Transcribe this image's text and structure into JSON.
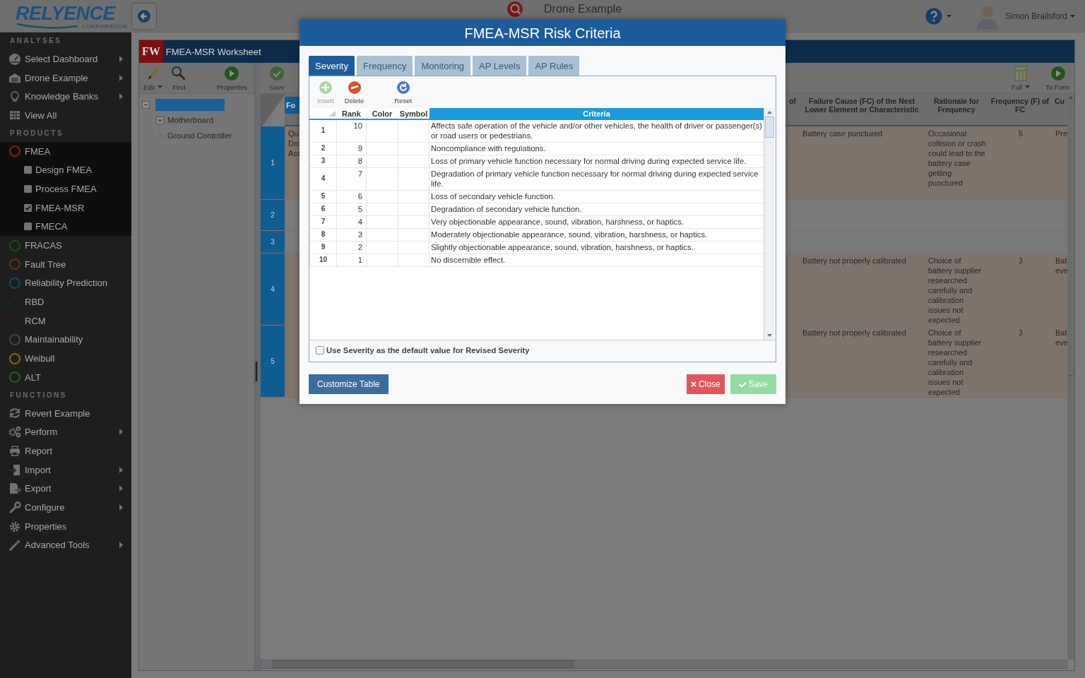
{
  "topbar": {
    "logo": "RELYENCE",
    "logo_sub": "CORPORATION",
    "title": "Drone Example",
    "user": "Simon Brailsford"
  },
  "sidebar": {
    "sections": [
      {
        "heading": "ANALYSES",
        "kind": "nav",
        "items": [
          {
            "label": "Select Dashboard",
            "submenu": true
          },
          {
            "label": "Drone Example",
            "submenu": true
          },
          {
            "label": "Knowledge Banks",
            "submenu": true
          },
          {
            "label": "View All",
            "submenu": false
          }
        ]
      },
      {
        "heading": "PRODUCTS",
        "kind": "products",
        "items": [
          {
            "label": "FMEA",
            "color": "#8c1c1c",
            "expanded": true,
            "children": [
              {
                "label": "Design FMEA",
                "checked": false
              },
              {
                "label": "Process FMEA",
                "checked": false
              },
              {
                "label": "FMEA-MSR",
                "checked": true
              },
              {
                "label": "FMECA",
                "checked": false
              }
            ]
          },
          {
            "label": "FRACAS",
            "color": "#1e4a1e",
            "expanded": false
          },
          {
            "label": "Fault Tree",
            "color": "#6e2a1c",
            "expanded": false
          },
          {
            "label": "Reliability Prediction",
            "color": "#124a62",
            "expanded": false
          },
          {
            "label": "RBD",
            "color": "#1a2438",
            "expanded": false
          },
          {
            "label": "RCM",
            "color": "#3a1414",
            "expanded": false
          },
          {
            "label": "Maintainability",
            "color": "#444444",
            "expanded": false
          },
          {
            "label": "Weibull",
            "color": "#7a6818",
            "expanded": false
          },
          {
            "label": "ALT",
            "color": "#2e5c1c",
            "expanded": false
          }
        ]
      },
      {
        "heading": "FUNCTIONS",
        "kind": "nav",
        "items": [
          {
            "label": "Revert Example",
            "submenu": false
          },
          {
            "label": "Perform",
            "submenu": true
          },
          {
            "label": "Report",
            "submenu": false
          },
          {
            "label": "Import",
            "submenu": true
          },
          {
            "label": "Export",
            "submenu": true
          },
          {
            "label": "Configure",
            "submenu": true
          },
          {
            "label": "Properties",
            "submenu": false
          },
          {
            "label": "Advanced Tools",
            "submenu": true
          }
        ]
      }
    ]
  },
  "worksheet": {
    "badge": "FW",
    "title": "FMEA-MSR Worksheet",
    "tree_tools": [
      {
        "label": "Edit",
        "dropdown": true
      },
      {
        "label": "Find",
        "dropdown": false
      },
      {
        "label": "Properties",
        "dropdown": false
      }
    ],
    "grid_tools": [
      {
        "label": "Save",
        "disabled": true,
        "dropdown": false
      }
    ],
    "grid_tools_right": [
      {
        "label": "Full",
        "dropdown": true
      },
      {
        "label": "To Form",
        "dropdown": false
      }
    ],
    "tree": {
      "selected": true,
      "children": [
        {
          "label": "Motherboard",
          "expandable": true
        },
        {
          "label": "Ground Controller",
          "expandable": false
        }
      ]
    },
    "grid": {
      "columns": [
        "Fo",
        null,
        "of",
        "Failure Cause (FC) of the Next Lower Element or Characteristic",
        "Rationale for Frequency",
        "Frequency (F) of FC",
        "Cu"
      ],
      "rows": [
        {
          "number": "1",
          "tinted": true,
          "cells": [
            "Qu Dro Ass",
            null,
            null,
            "Battery case punctured",
            "Occasional collision or crash could lead to the battery case getting punctured",
            "5",
            "Pre"
          ]
        },
        {
          "number": "2",
          "tinted": false,
          "cells": [
            null,
            null,
            null,
            null,
            null,
            null,
            null
          ]
        },
        {
          "number": "3",
          "tinted": false,
          "cells": [
            null,
            null,
            null,
            null,
            null,
            null,
            null
          ]
        },
        {
          "number": "4",
          "tinted": true,
          "cells": [
            null,
            null,
            null,
            "Battery not properly calibrated",
            "Choice of battery supplier researched carefully and calibration issues not expected",
            "3",
            "Bat eve"
          ]
        },
        {
          "number": "5",
          "tinted": true,
          "cells": [
            null,
            null,
            null,
            "Battery not properly calibrated",
            "Choice of battery supplier researched carefully and calibration issues not expected",
            "3",
            "Bat eve"
          ]
        }
      ]
    }
  },
  "dialog": {
    "title": "FMEA-MSR Risk Criteria",
    "tabs": [
      {
        "label": "Severity",
        "selected": true
      },
      {
        "label": "Frequency",
        "selected": false
      },
      {
        "label": "Monitoring",
        "selected": false
      },
      {
        "label": "AP Levels",
        "selected": false
      },
      {
        "label": "AP Rules",
        "selected": false
      }
    ],
    "tools": [
      {
        "label": "Insert",
        "disabled": true
      },
      {
        "label": "Delete",
        "disabled": false
      },
      {
        "label": "Reset",
        "disabled": false
      }
    ],
    "table": {
      "columns": [
        "Rank",
        "Color",
        "Symbol",
        "Criteria"
      ],
      "rows": [
        {
          "number": "1",
          "rank": "10",
          "criteria": "Affects safe operation of the vehicle and/or other vehicles, the health of driver or passenger(s) or road users or pedestrians."
        },
        {
          "number": "2",
          "rank": "9",
          "criteria": "Noncompliance with regulations."
        },
        {
          "number": "3",
          "rank": "8",
          "criteria": "Loss of primary vehicle function necessary for normal driving during expected service life."
        },
        {
          "number": "4",
          "rank": "7",
          "criteria": "Degradation of primary vehicle function necessary for normal driving during expected service life."
        },
        {
          "number": "5",
          "rank": "6",
          "criteria": "Loss of secondary vehicle function."
        },
        {
          "number": "6",
          "rank": "5",
          "criteria": "Degradation of secondary vehicle function."
        },
        {
          "number": "7",
          "rank": "4",
          "criteria": "Very objectionable appearance, sound, vibration, harshness, or haptics."
        },
        {
          "number": "8",
          "rank": "3",
          "criteria": "Moderately objectionable appearance, sound, vibration, harshness, or haptics."
        },
        {
          "number": "9",
          "rank": "2",
          "criteria": "Slightly objectionable appearance, sound, vibration, harshness, or haptics."
        },
        {
          "number": "10",
          "rank": "1",
          "criteria": "No discernible effect."
        }
      ]
    },
    "option": {
      "label": "Use Severity as the default value for Revised Severity",
      "checked": false
    },
    "buttons": [
      {
        "label": "Customize Table",
        "kind": "secondary"
      },
      {
        "label": "Close",
        "kind": "danger"
      },
      {
        "label": "Save",
        "kind": "confirm",
        "disabled": true
      }
    ]
  }
}
